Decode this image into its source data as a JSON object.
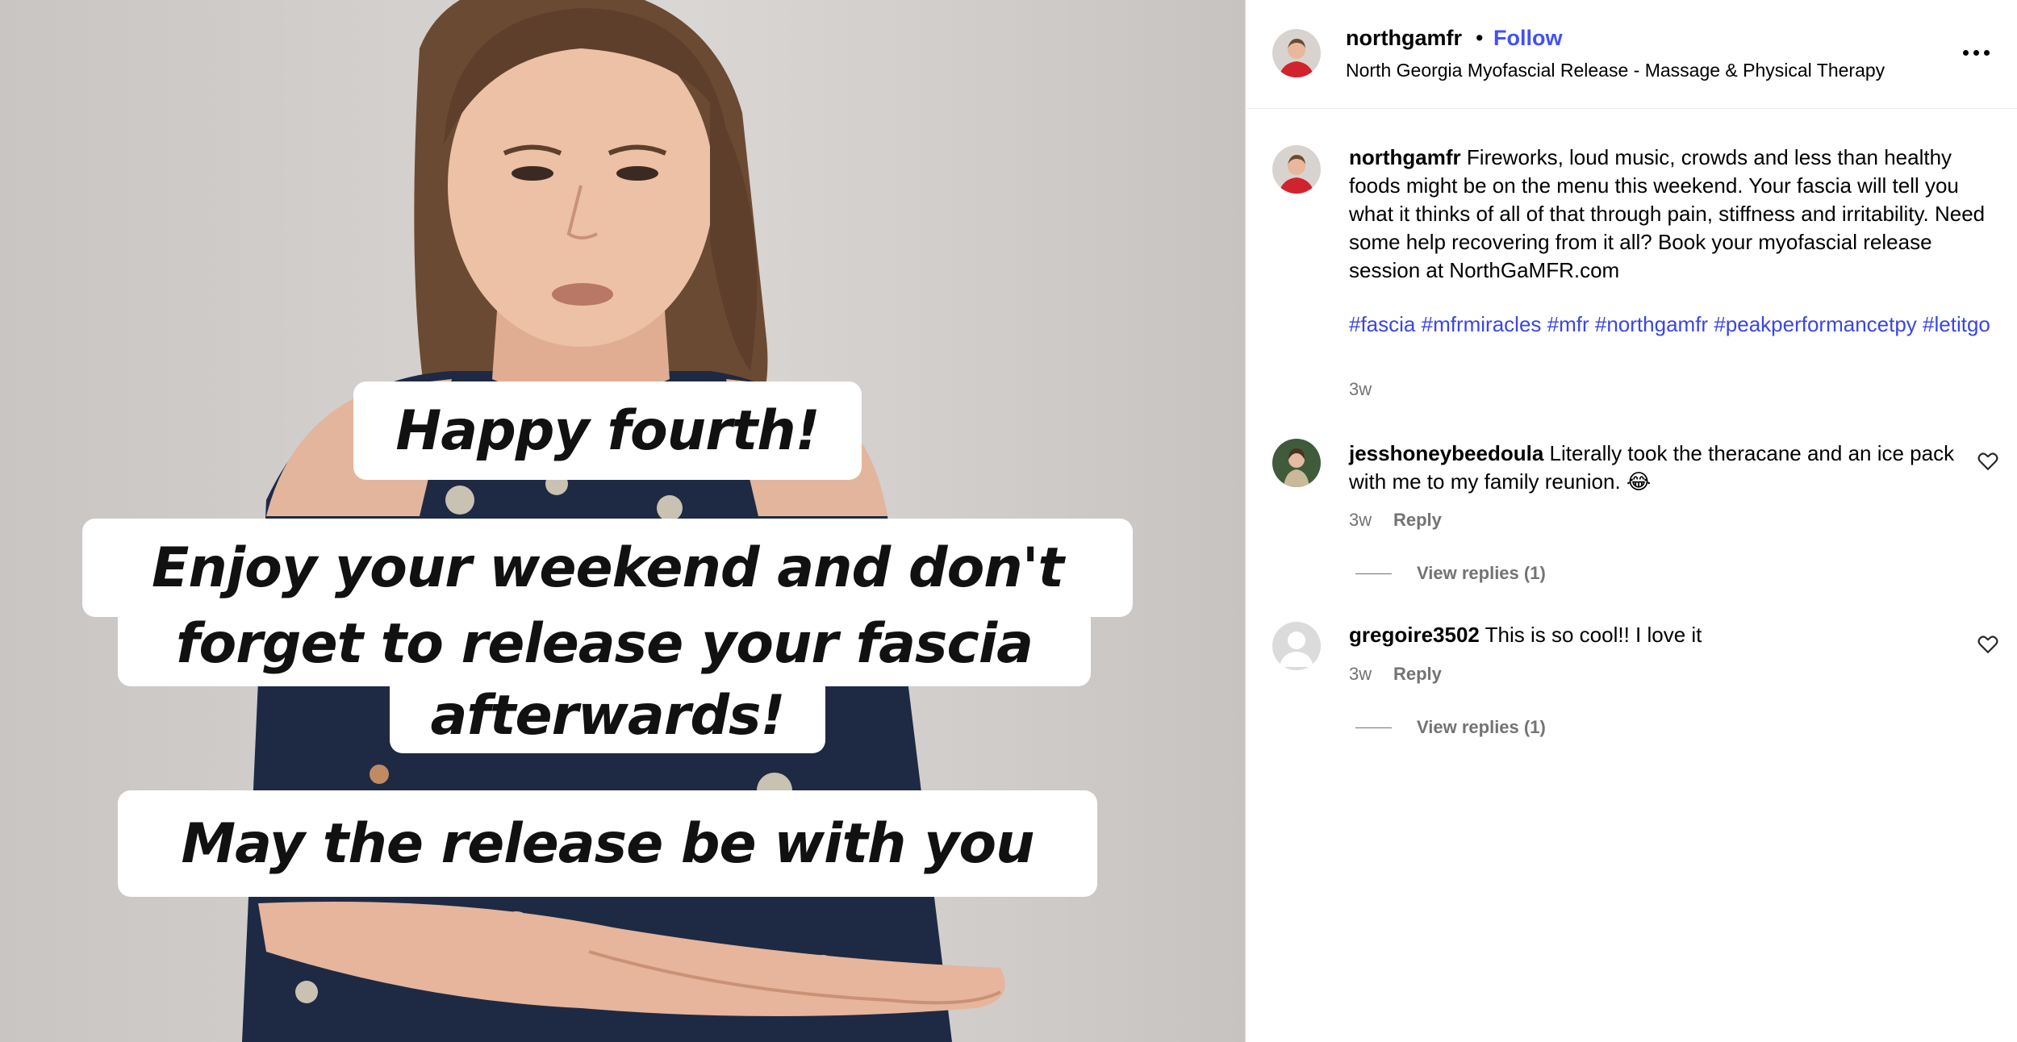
{
  "post": {
    "username": "northgamfr",
    "follow_label": "Follow",
    "separator": "•",
    "subtitle": "North Georgia Myofascial Release - Massage & Physical Therapy",
    "more_icon": "more-horizontal-icon"
  },
  "media": {
    "caption_line1": "Happy fourth!",
    "caption_line2a": "Enjoy your weekend and don't",
    "caption_line2b": "forget to release your fascia",
    "caption_line2c": "afterwards!",
    "caption_line3": "May the release be with you"
  },
  "caption": {
    "username": "northgamfr",
    "text": "Fireworks, loud music, crowds and less than healthy foods might be on the menu this weekend. Your fascia will tell you what it thinks of all of that through pain, stiffness and irritability. Need some help recovering from it all? Book your myofascial release session at NorthGaMFR.com",
    "hashtags": [
      "#fascia",
      "#mfrmiracles",
      "#mfr",
      "#northgamfr",
      "#peakperformancetpy",
      "#letitgo"
    ],
    "time": "3w"
  },
  "comments": [
    {
      "username": "jesshoneybeedoula",
      "text": "Literally took the theracane and an ice pack with me to my family reunion. 😂",
      "time": "3w",
      "reply_label": "Reply",
      "view_replies": "View replies (1)"
    },
    {
      "username": "gregoire3502",
      "text": "This is so cool!! I love it",
      "time": "3w",
      "reply_label": "Reply",
      "view_replies": "View replies (1)"
    }
  ],
  "colors": {
    "follow": "#4150f7",
    "hashtag": "#3b46e0",
    "muted": "#737373"
  }
}
